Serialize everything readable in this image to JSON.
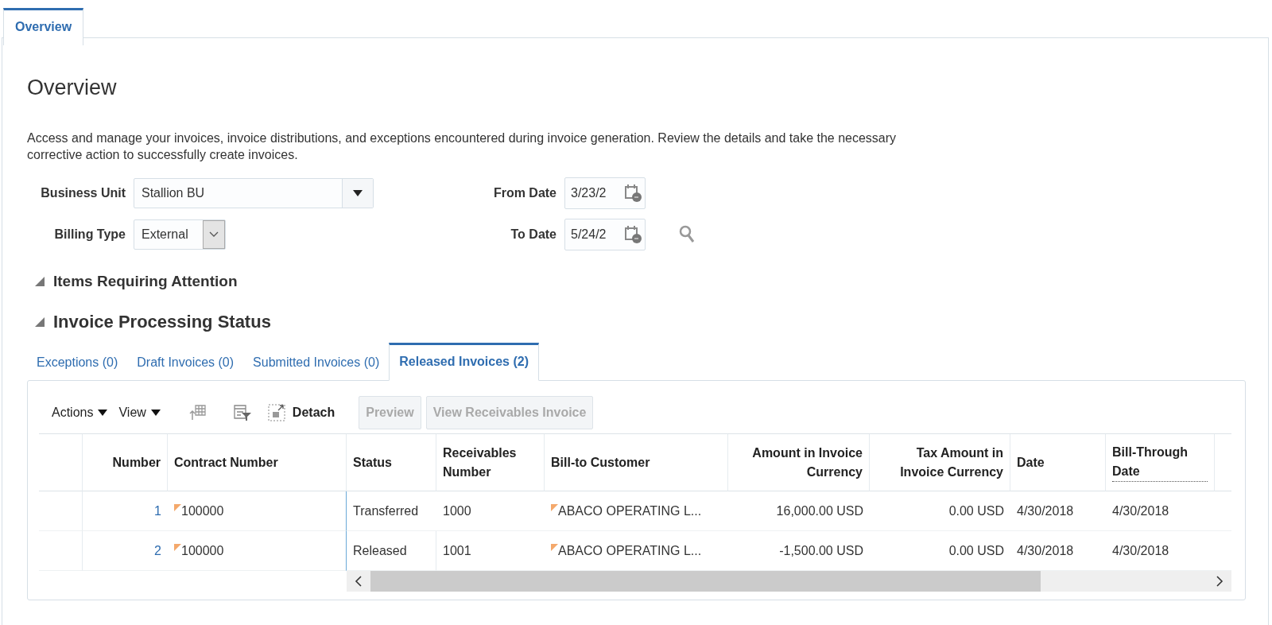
{
  "page_tabs": [
    {
      "label": "Overview",
      "selected": true
    }
  ],
  "title": "Overview",
  "description": "Access and manage your invoices, invoice distributions, and exceptions encountered during invoice generation. Review the details and take the necessary corrective action to successfully create invoices.",
  "filters": {
    "business_unit": {
      "label": "Business Unit",
      "value": "Stallion BU"
    },
    "billing_type": {
      "label": "Billing Type",
      "value": "External"
    },
    "from_date": {
      "label": "From Date",
      "value": "3/23/2"
    },
    "to_date": {
      "label": "To Date",
      "value": "5/24/2"
    }
  },
  "sections": [
    {
      "title": "Items Requiring Attention",
      "expanded": true,
      "kind": "minor"
    },
    {
      "title": "Invoice Processing Status",
      "expanded": true,
      "kind": "major"
    }
  ],
  "status_tabs": [
    {
      "label": "Exceptions (0)",
      "selected": false
    },
    {
      "label": "Draft Invoices (0)",
      "selected": false
    },
    {
      "label": "Submitted Invoices (0)",
      "selected": false
    },
    {
      "label": "Released Invoices (2)",
      "selected": true
    }
  ],
  "toolbar": {
    "actions": "Actions",
    "view": "View",
    "detach": "Detach",
    "buttons": [
      {
        "label": "Preview",
        "disabled": true
      },
      {
        "label": "View Receivables Invoice",
        "disabled": true
      }
    ]
  },
  "table": {
    "columns": [
      "Number",
      "Contract Number",
      "Status",
      "Receivables Number",
      "Bill-to Customer",
      "Amount in Invoice Currency",
      "Tax Amount in Invoice Currency",
      "Date",
      "Bill-Through Date"
    ],
    "rows": [
      [
        "1",
        "100000",
        "Transferred",
        "1000",
        "ABACO OPERATING L...",
        "16,000.00 USD",
        "0.00 USD",
        "4/30/2018",
        "4/30/2018"
      ],
      [
        "2",
        "100000",
        "Released",
        "1001",
        "ABACO OPERATING L...",
        "-1,500.00 USD",
        "0.00 USD",
        "4/30/2018",
        "4/30/2018"
      ]
    ]
  }
}
